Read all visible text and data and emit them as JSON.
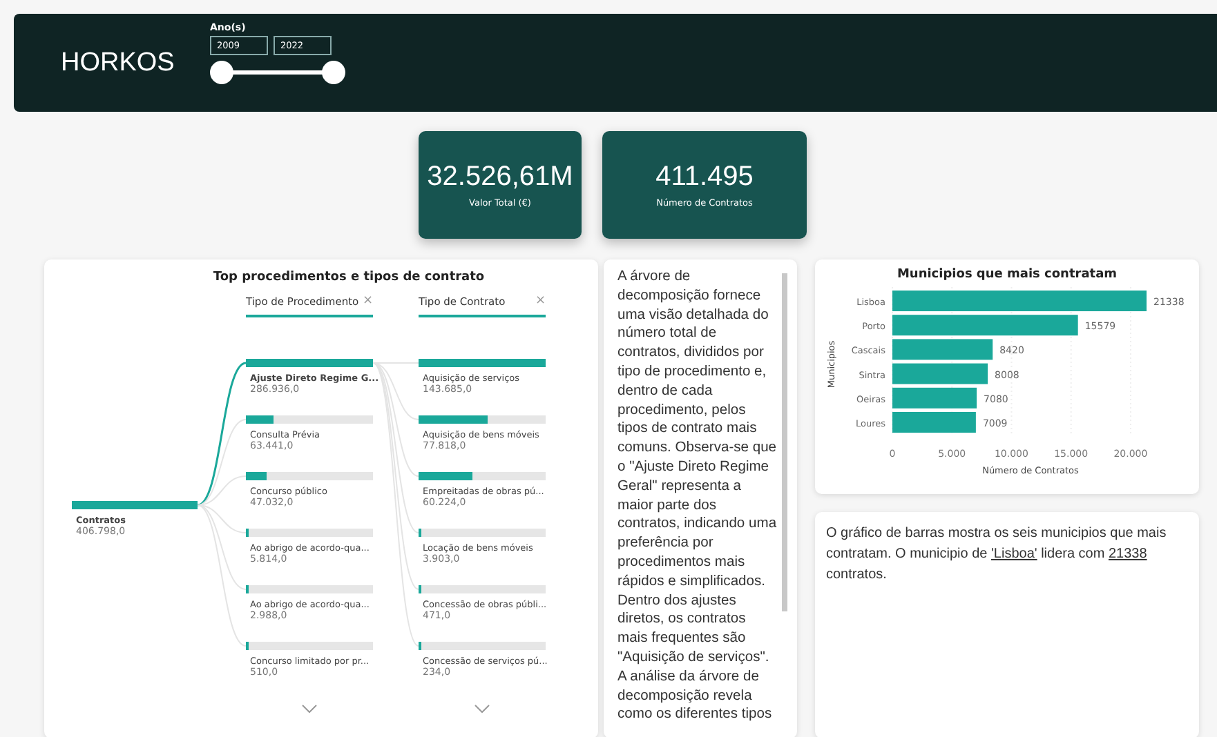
{
  "header": {
    "title": "HORKOS",
    "year_filter": {
      "label": "Ano(s)",
      "from": "2009",
      "to": "2022",
      "thumbs": [
        {
          "level": 0
        },
        {
          "level": 1
        }
      ]
    }
  },
  "kpis": [
    {
      "value": "32.526,61M",
      "label": "Valor Total  (€)"
    },
    {
      "value": "411.495",
      "label": "Número de Contratos"
    }
  ],
  "decomposition_tree": {
    "title": "Top procedimentos e tipos de contrato",
    "root": {
      "label": "Contratos",
      "value": "406.798,0",
      "level": 1
    },
    "columns": [
      {
        "header": "Tipo de Procedimento",
        "close": "×",
        "more": true,
        "nodes": [
          {
            "label": "Ajuste Direto Regime G...",
            "value": "286.936,0",
            "level": 1,
            "selected": true
          },
          {
            "label": "Consulta Prévia",
            "value": "63.441,0",
            "level": 0.22,
            "selected": false
          },
          {
            "label": "Concurso público",
            "value": "47.032,0",
            "level": 0.16,
            "selected": false
          },
          {
            "label": "Ao abrigo de acordo-qua...",
            "value": "5.814,0",
            "level": 0.02,
            "selected": false
          },
          {
            "label": "Ao abrigo de acordo-qua...",
            "value": "2.988,0",
            "level": 0.01,
            "selected": false
          },
          {
            "label": "Concurso limitado por pr...",
            "value": "510,0",
            "level": 0.002,
            "selected": false
          }
        ]
      },
      {
        "header": "Tipo de Contrato",
        "close": "×",
        "more": true,
        "nodes": [
          {
            "label": "Aquisição de serviços",
            "value": "143.685,0",
            "level": 1,
            "selected": false
          },
          {
            "label": "Aquisição de bens móveis",
            "value": "77.818,0",
            "level": 0.54,
            "selected": false
          },
          {
            "label": "Empreitadas de obras pú...",
            "value": "60.224,0",
            "level": 0.42,
            "selected": false
          },
          {
            "label": "Locação de bens móveis",
            "value": "3.903,0",
            "level": 0.027,
            "selected": false
          },
          {
            "label": "Concessão de obras públi...",
            "value": "471,0",
            "level": 0.003,
            "selected": false
          },
          {
            "label": "Concessão de serviços pú...",
            "value": "234,0",
            "level": 0.002,
            "selected": false
          }
        ]
      }
    ]
  },
  "tree_description": "A árvore de decomposição fornece uma visão detalhada do número total de contratos, divididos por tipo de procedimento e, dentro de cada procedimento, pelos tipos de contrato mais comuns. Observa-se que o \"Ajuste Direto Regime Geral\" representa a maior parte dos contratos, indicando uma preferência por procedimentos mais rápidos e simplificados. Dentro dos ajustes diretos, os contratos mais frequentes são \"Aquisição de serviços\". A análise da árvore de decomposição revela como os diferentes tipos",
  "municipalities_chart": {
    "chart_data": {
      "type": "bar",
      "orientation": "horizontal",
      "title": "Municipios que mais contratam",
      "xlabel": "Número de Contratos",
      "ylabel": "Municipios",
      "categories": [
        "Lisboa",
        "Porto",
        "Cascais",
        "Sintra",
        "Oeiras",
        "Loures"
      ],
      "series": [
        {
          "color": "#1aa89a",
          "values": [
            21338,
            15579,
            8420,
            8008,
            7080,
            7009
          ]
        }
      ],
      "xlim": [
        0,
        21338
      ],
      "xticks": [
        0,
        {
          "value": 5000,
          "label": "5.000"
        },
        {
          "value": 10000,
          "label": "10.000"
        },
        {
          "value": 15000,
          "label": "15.000"
        },
        {
          "value": 20000,
          "label": "20.000"
        }
      ],
      "grid": true,
      "data_labels": true
    }
  },
  "chart_description": [
    {
      "text": "O gráfico de barras mostra os seis municipios que mais contratam. O municipio de  ",
      "underlined": false
    },
    {
      "text": "'Lisboa'",
      "underlined": true
    },
    {
      "text": " lidera com ",
      "underlined": false
    },
    {
      "text": "21338",
      "underlined": true
    },
    {
      "text": " contratos.",
      "underlined": false
    }
  ]
}
